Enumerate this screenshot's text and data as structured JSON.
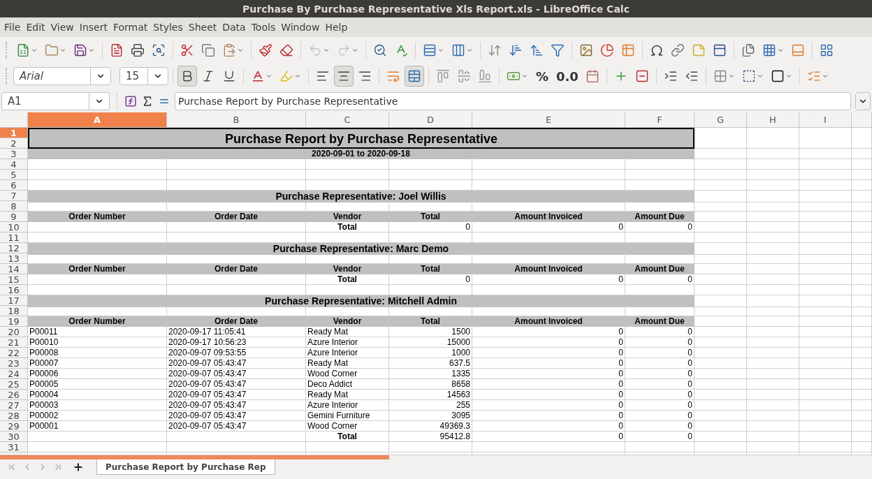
{
  "window": {
    "title": "Purchase By Purchase Representative Xls Report.xls - LibreOffice Calc"
  },
  "menu": [
    "File",
    "Edit",
    "View",
    "Insert",
    "Format",
    "Styles",
    "Sheet",
    "Data",
    "Tools",
    "Window",
    "Help"
  ],
  "formatting": {
    "font_name": "Arial",
    "font_size": "15",
    "bold": true,
    "italic": false,
    "underline": false,
    "wrap": false,
    "merge": true,
    "number_formats": [
      "%",
      "0.0"
    ],
    "align_buttons": [
      {
        "kind": "left",
        "selected": false
      },
      {
        "kind": "center",
        "selected": true
      },
      {
        "kind": "right",
        "selected": false
      }
    ]
  },
  "formula_bar": {
    "name_box": "A1",
    "formula": "Purchase Report by Purchase Representative"
  },
  "columns": [
    {
      "label": "A",
      "selected": true
    },
    {
      "label": "B",
      "selected": false
    },
    {
      "label": "C",
      "selected": false
    },
    {
      "label": "D",
      "selected": false
    },
    {
      "label": "E",
      "selected": false
    },
    {
      "label": "F",
      "selected": false
    },
    {
      "label": "G",
      "selected": false
    },
    {
      "label": "H",
      "selected": false
    },
    {
      "label": "I",
      "selected": false
    }
  ],
  "row_numbers": [
    {
      "label": "1",
      "selected": true
    },
    {
      "label": "2",
      "selected": false
    },
    {
      "label": "3",
      "selected": false
    },
    {
      "label": "4",
      "selected": false
    },
    {
      "label": "5",
      "selected": false
    },
    {
      "label": "6",
      "selected": false
    },
    {
      "label": "7",
      "selected": false
    },
    {
      "label": "8",
      "selected": false
    },
    {
      "label": "9",
      "selected": false
    },
    {
      "label": "10",
      "selected": false
    },
    {
      "label": "11",
      "selected": false
    },
    {
      "label": "12",
      "selected": false
    },
    {
      "label": "13",
      "selected": false
    },
    {
      "label": "14",
      "selected": false
    },
    {
      "label": "15",
      "selected": false
    },
    {
      "label": "16",
      "selected": false
    },
    {
      "label": "17",
      "selected": false
    },
    {
      "label": "18",
      "selected": false
    },
    {
      "label": "19",
      "selected": false
    },
    {
      "label": "20",
      "selected": false
    },
    {
      "label": "21",
      "selected": false
    },
    {
      "label": "22",
      "selected": false
    },
    {
      "label": "23",
      "selected": false
    },
    {
      "label": "24",
      "selected": false
    },
    {
      "label": "25",
      "selected": false
    },
    {
      "label": "26",
      "selected": false
    },
    {
      "label": "27",
      "selected": false
    },
    {
      "label": "28",
      "selected": false
    },
    {
      "label": "29",
      "selected": false
    },
    {
      "label": "30",
      "selected": false
    },
    {
      "label": "31",
      "selected": false
    }
  ],
  "report": {
    "title": "Purchase Report by Purchase Representative",
    "date_range": "2020-09-01 to 2020-09-18",
    "sections": [
      {
        "heading": "Purchase Representative: Joel Willis",
        "headers": [
          "Order Number",
          "Order Date",
          "Vendor",
          "Total",
          "Amount Invoiced",
          "Amount Due"
        ],
        "total": {
          "label": "Total",
          "values": [
            "0",
            "0",
            "0"
          ]
        }
      },
      {
        "heading": "Purchase Representative: Marc Demo",
        "headers": [
          "Order Number",
          "Order Date",
          "Vendor",
          "Total",
          "Amount Invoiced",
          "Amount Due"
        ],
        "total": {
          "label": "Total",
          "values": [
            "0",
            "0",
            "0"
          ]
        }
      },
      {
        "heading": "Purchase Representative: Mitchell Admin",
        "headers": [
          "Order Number",
          "Order Date",
          "Vendor",
          "Total",
          "Amount Invoiced",
          "Amount Due"
        ],
        "rows": [
          [
            "P00011",
            "2020-09-17 11:05:41",
            "Ready Mat",
            "1500",
            "0",
            "0"
          ],
          [
            "P00010",
            "2020-09-17 10:56:23",
            "Azure Interior",
            "15000",
            "0",
            "0"
          ],
          [
            "P00008",
            "2020-09-07 09:53:55",
            "Azure Interior",
            "1000",
            "0",
            "0"
          ],
          [
            "P00007",
            "2020-09-07 05:43:47",
            "Ready Mat",
            "637.5",
            "0",
            "0"
          ],
          [
            "P00006",
            "2020-09-07 05:43:47",
            "Wood Corner",
            "1335",
            "0",
            "0"
          ],
          [
            "P00005",
            "2020-09-07 05:43:47",
            "Deco Addict",
            "8658",
            "0",
            "0"
          ],
          [
            "P00004",
            "2020-09-07 05:43:47",
            "Ready Mat",
            "14563",
            "0",
            "0"
          ],
          [
            "P00003",
            "2020-09-07 05:43:47",
            "Azure Interior",
            "255",
            "0",
            "0"
          ],
          [
            "P00002",
            "2020-09-07 05:43:47",
            "Gemini Furniture",
            "3095",
            "0",
            "0"
          ],
          [
            "P00001",
            "2020-09-07 05:43:47",
            "Wood Corner",
            "49369.3",
            "0",
            "0"
          ]
        ],
        "total": {
          "label": "Total",
          "values": [
            "95412.8",
            "0",
            "0"
          ]
        }
      }
    ]
  },
  "sheet_tabs": [
    {
      "label": "Purchase Report by Purchase Rep",
      "selected": true
    }
  ]
}
